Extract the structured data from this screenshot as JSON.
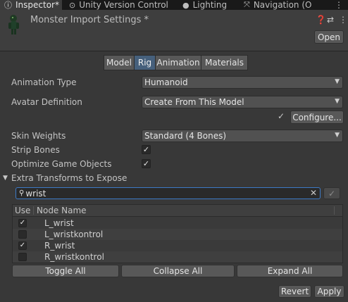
{
  "tabs": [
    {
      "label": "Inspector*",
      "icon": "info-icon"
    },
    {
      "label": "Unity Version Control",
      "icon": "vcs-icon"
    },
    {
      "label": "Lighting",
      "icon": "lightbulb-icon"
    },
    {
      "label": "Navigation (O",
      "icon": "navigation-icon"
    }
  ],
  "header": {
    "title": "Monster Import Settings *",
    "open_label": "Open"
  },
  "rig_tabs": [
    "Model",
    "Rig",
    "Animation",
    "Materials"
  ],
  "selected_tab": "Rig",
  "fields": {
    "animation_type_label": "Animation Type",
    "animation_type_value": "Humanoid",
    "avatar_definition_label": "Avatar Definition",
    "avatar_definition_value": "Create From This Model",
    "configure_label": "Configure...",
    "skin_weights_label": "Skin Weights",
    "skin_weights_value": "Standard (4 Bones)",
    "strip_bones_label": "Strip Bones",
    "optimize_label": "Optimize Game Objects",
    "extra_transforms_label": "Extra Transforms to Expose"
  },
  "search": {
    "value": "wrist"
  },
  "table": {
    "col_use": "Use",
    "col_node": "Node Name",
    "rows": [
      {
        "name": "L_wrist",
        "checked": true
      },
      {
        "name": "L_wristkontrol",
        "checked": false
      },
      {
        "name": "R_wrist",
        "checked": true
      },
      {
        "name": "R_wristkontrol",
        "checked": false
      }
    ]
  },
  "buttons": {
    "toggle_all": "Toggle All",
    "collapse_all": "Collapse All",
    "expand_all": "Expand All",
    "revert": "Revert",
    "apply": "Apply"
  },
  "colors": {
    "background": "#383838",
    "selected_tab": "#46607c",
    "search_focus": "#3d7ac6"
  }
}
